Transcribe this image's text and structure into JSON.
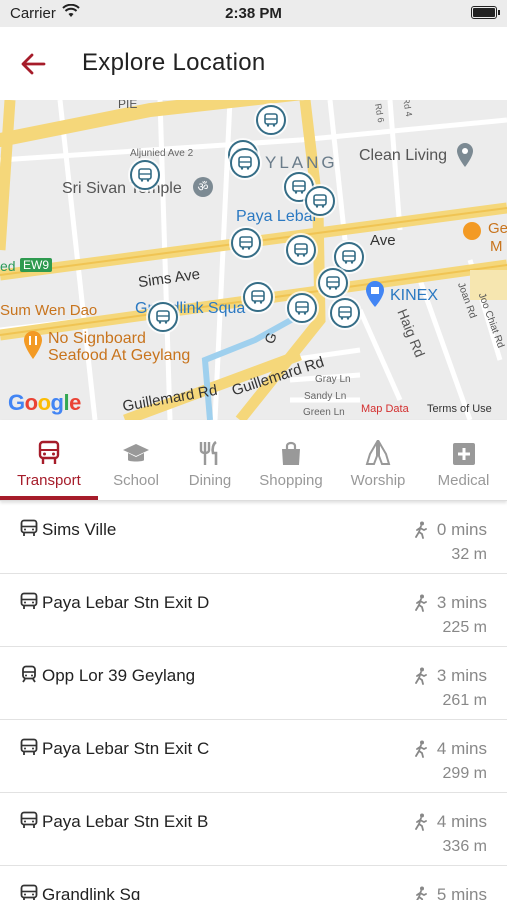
{
  "status_bar": {
    "carrier": "Carrier",
    "time": "2:38 PM"
  },
  "header": {
    "title": "Explore Location"
  },
  "map": {
    "labels": {
      "pie": "PIE",
      "aljunied": "Aljunied Ave 2",
      "geylang": "YLANG",
      "clean_living": "Clean Living",
      "sri_sivan": "Sri Sivan Temple",
      "paya_lebar": "Paya Lebar",
      "ave": "Ave",
      "ge": "Ge",
      "m": "M",
      "ew9": "EW9",
      "ed": "ed",
      "sims_ave": "Sims Ave",
      "kinex": "KINEX",
      "sum_wen_dao": "Sum Wen Dao",
      "grandlink_square": "Grandlink Squa",
      "g": "G",
      "haig_rd": "Haig Rd",
      "joan_rd": "Joan Rd",
      "joo_chiat_rd": "Joo Chiat Rd",
      "no_signboard_1": "No Signboard",
      "no_signboard_2": "Seafood At Geylang",
      "guillemard_rd_1": "Guillemard Rd",
      "guillemard_rd_2": "Guillemard Rd",
      "gray_ln": "Gray Ln",
      "sandy_ln": "Sandy Ln",
      "green_ln": "Green Ln",
      "rd6": "Rd 6",
      "rd4": "Rd 4"
    },
    "google": "Google",
    "map_data": "Map Data",
    "terms": "Terms of Use"
  },
  "tabs": [
    {
      "label": "Transport",
      "icon": "bus-icon",
      "active": true
    },
    {
      "label": "School",
      "icon": "graduation-cap-icon",
      "active": false
    },
    {
      "label": "Dining",
      "icon": "fork-knife-icon",
      "active": false
    },
    {
      "label": "Shopping",
      "icon": "shopping-bag-icon",
      "active": false
    },
    {
      "label": "Worship",
      "icon": "praying-hands-icon",
      "active": false
    },
    {
      "label": "Medical",
      "icon": "medical-cross-icon",
      "active": false
    }
  ],
  "stops": [
    {
      "name": "Sims Ville",
      "mins": "0 mins",
      "dist": "32 m",
      "type": "bus"
    },
    {
      "name": "Paya Lebar Stn Exit D",
      "mins": "3 mins",
      "dist": "225 m",
      "type": "bus"
    },
    {
      "name": "Opp Lor 39 Geylang",
      "mins": "3 mins",
      "dist": "261 m",
      "type": "train"
    },
    {
      "name": "Paya Lebar Stn Exit C",
      "mins": "4 mins",
      "dist": "299 m",
      "type": "bus"
    },
    {
      "name": "Paya Lebar Stn Exit B",
      "mins": "4 mins",
      "dist": "336 m",
      "type": "bus"
    },
    {
      "name": "Grandlink Sq",
      "mins": "5 mins",
      "dist": "",
      "type": "bus"
    }
  ],
  "colors": {
    "accent": "#a61c2a",
    "pin_border": "#356d86",
    "road_yellow": "#f5d77a",
    "map_bg": "#ececec"
  }
}
